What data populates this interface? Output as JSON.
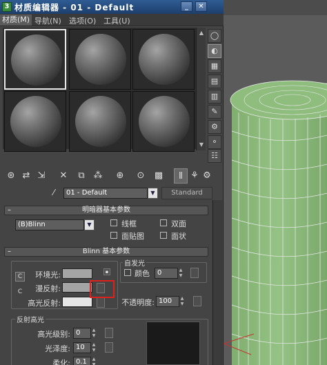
{
  "window": {
    "title": "材质编辑器 - 01 - Default",
    "minimize_glyph": "_",
    "close_glyph": "✕"
  },
  "menu": [
    "材质(M)",
    "导航(N)",
    "选项(O)",
    "工具(U)"
  ],
  "material": {
    "name": "01 - Default",
    "type": "Standard"
  },
  "shader_basic": {
    "header": "明暗器基本参数",
    "shader": "(B)Blinn",
    "options": [
      "线框",
      "双面",
      "面贴图",
      "面状"
    ]
  },
  "blinn": {
    "header": "Blinn 基本参数",
    "ambient_label": "环境光:",
    "diffuse_label": "漫反射:",
    "specular_label": "高光反射:",
    "lock_glyph_a": "C",
    "lock_glyph_b": "C",
    "ambient_color": "#a4a4a4",
    "diffuse_color": "#a4a4a4",
    "specular_color": "#e6e6e6",
    "self_illum": {
      "title": "自发光",
      "color_label": "颜色",
      "value": "0"
    },
    "opacity_label": "不透明度:",
    "opacity_value": "100",
    "specular_highlights": {
      "title": "反射高光",
      "level_label": "高光级别:",
      "level_value": "0",
      "gloss_label": "光泽度:",
      "gloss_value": "10",
      "soften_label": "柔化:",
      "soften_value": "0.1"
    }
  },
  "colors": {
    "title_bar": "#2f5c93",
    "cylinder": "#8ab97a",
    "highlight": "#e0201c"
  }
}
